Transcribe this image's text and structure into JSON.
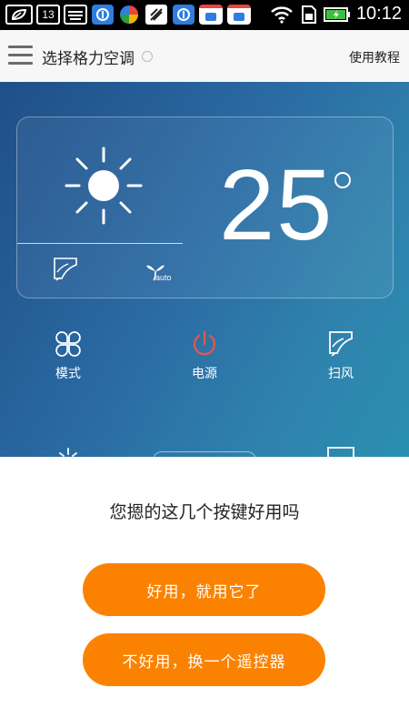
{
  "status_bar": {
    "notification_count": "13",
    "time": "10:12",
    "icons": [
      "leaf-icon",
      "notification-count-icon",
      "keyboard-icon",
      "app-store-icon",
      "pinwheel-app-icon",
      "signal-app-icon",
      "app-store-icon",
      "wallet-app-icon",
      "wallet-app-icon",
      "wifi-icon",
      "sim-icon",
      "battery-charging-icon"
    ]
  },
  "app_bar": {
    "title": "选择格力空调",
    "tutorial_label": "使用教程",
    "menu_icon": "hamburger-menu-icon"
  },
  "remote": {
    "temperature": "25",
    "temperature_unit_icon": "degree-icon",
    "mode_icon": "sun-icon",
    "swing_icon": "swing-icon",
    "fan_icon": "fan-icon",
    "fan_label": "auto",
    "controls": [
      {
        "name": "mode",
        "label": "模式",
        "icon": "clover-icon"
      },
      {
        "name": "power",
        "label": "电源",
        "icon": "power-icon"
      },
      {
        "name": "swing",
        "label": "扫风",
        "icon": "swing-icon"
      }
    ],
    "colors": {
      "power": "#e0574a",
      "panel_start": "#1f4f88",
      "panel_end": "#2a8fb0"
    }
  },
  "sheet": {
    "question": "您摁的这几个按键好用吗",
    "good_label": "好用，就用它了",
    "bad_label": "不好用，换一个遥控器",
    "accent_color": "#fb8200"
  }
}
